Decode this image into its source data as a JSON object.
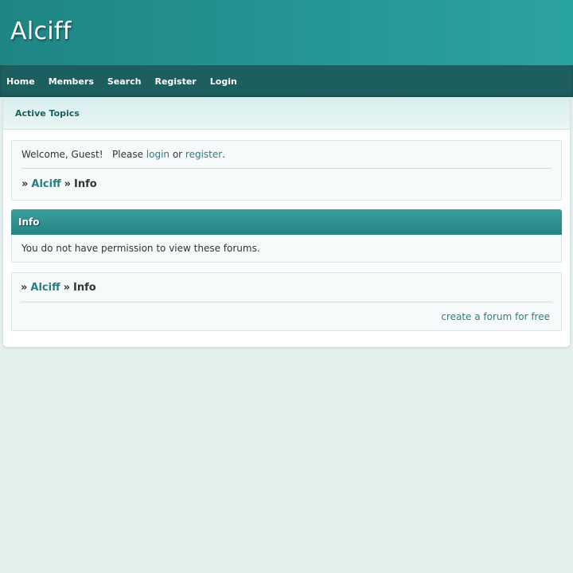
{
  "header": {
    "site_title": "Alciff"
  },
  "nav": {
    "items": [
      {
        "label": "Home"
      },
      {
        "label": "Members"
      },
      {
        "label": "Search"
      },
      {
        "label": "Register"
      },
      {
        "label": "Login"
      }
    ]
  },
  "subbar": {
    "active_topics": "Active Topics"
  },
  "welcome": {
    "prefix": "Welcome, Guest!   Please ",
    "login_link": "login",
    "or_text": " or ",
    "register_link": "register",
    "suffix": "."
  },
  "breadcrumb": {
    "arrow1": "»",
    "forum": "Alciff",
    "arrow2": "»",
    "current": "Info"
  },
  "section": {
    "title": "Info",
    "message": "You do not have permission to view these forums."
  },
  "footer": {
    "create_forum_link": "create a forum for free"
  },
  "colors": {
    "header_gradient_start": "#1f8585",
    "header_gradient_end": "#2aa3a3",
    "nav_bg": "#1d5e5e",
    "link": "#2a8080",
    "page_bg": "#e3efed"
  }
}
